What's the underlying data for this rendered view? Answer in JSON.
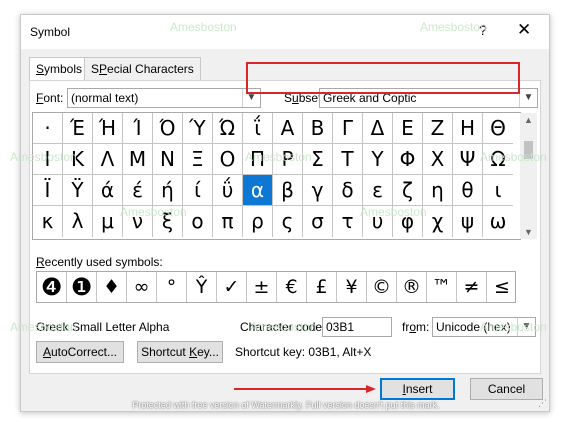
{
  "dialog": {
    "title": "Symbol",
    "help_glyph": "?",
    "close_glyph": "✕"
  },
  "tabs": [
    {
      "label": "Symbols",
      "key": "S",
      "rest": "ymbols",
      "active": true
    },
    {
      "label": "Special Characters",
      "key": "P",
      "rest": "ecial Characters",
      "pre": "S",
      "active": false
    }
  ],
  "font": {
    "label_key": "F",
    "label_rest": "ont:",
    "value": "(normal text)"
  },
  "subset": {
    "label_key": "u",
    "label_pre": "S",
    "label_rest": "bset:",
    "value": "Greek and Coptic",
    "highlight_color": "#d9262b"
  },
  "symbol_grid": {
    "rows": [
      [
        "·",
        "Έ",
        "Ή",
        "Ί",
        "Ό",
        "Ύ",
        "Ώ",
        "ΐ",
        "Α",
        "Β",
        "Γ",
        "Δ",
        "Ε",
        "Ζ",
        "Η",
        "Θ"
      ],
      [
        "Ι",
        "Κ",
        "Λ",
        "Μ",
        "Ν",
        "Ξ",
        "Ο",
        "Π",
        "Ρ",
        "Σ",
        "Τ",
        "Υ",
        "Φ",
        "Χ",
        "Ψ",
        "Ω"
      ],
      [
        "Ϊ",
        "Ϋ",
        "ά",
        "έ",
        "ή",
        "ί",
        "ΰ",
        "α",
        "β",
        "γ",
        "δ",
        "ε",
        "ζ",
        "η",
        "θ",
        "ι"
      ],
      [
        "κ",
        "λ",
        "μ",
        "ν",
        "ξ",
        "ο",
        "π",
        "ρ",
        "ς",
        "σ",
        "τ",
        "υ",
        "φ",
        "χ",
        "ψ",
        "ω"
      ]
    ],
    "selected": {
      "row": 2,
      "col": 7
    },
    "selected_color": "#0c78d4"
  },
  "recent": {
    "label_key": "R",
    "label_rest": "ecently used symbols:",
    "symbols": [
      "❹",
      "❶",
      "♦",
      "∞",
      "°",
      "Ŷ",
      "✓",
      "±",
      "€",
      "£",
      "¥",
      "©",
      "®",
      "™",
      "≠",
      "≤"
    ]
  },
  "char_name": "Greek Small Letter Alpha",
  "char_code": {
    "label": "Character code:",
    "value": "03B1"
  },
  "from": {
    "label_pre": "fr",
    "label_key": "o",
    "label_rest": "m:",
    "value": "Unicode (hex)"
  },
  "buttons": {
    "autocorrect": {
      "pre": "",
      "key": "A",
      "rest": "utoCorrect..."
    },
    "shortcut_key": {
      "pre": "Shortcut ",
      "key": "K",
      "rest": "ey..."
    },
    "insert": {
      "pre": "",
      "key": "I",
      "rest": "nsert"
    },
    "cancel": "Cancel"
  },
  "shortcut_text": "Shortcut key: 03B1, Alt+X",
  "annotation_arrow_color": "#d9262b",
  "watermark_text": "Amesboston",
  "footer_note": "Protected with free version of Watermarkly. Full version doesn't put this mark."
}
